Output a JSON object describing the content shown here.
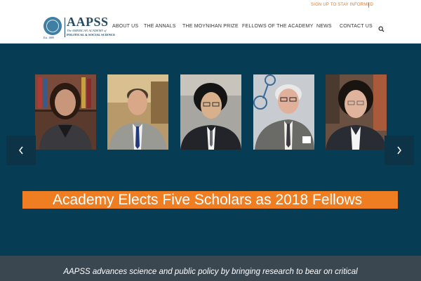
{
  "topbar": {
    "signup_label": "SIGN UP TO STAY INFORMED"
  },
  "logo": {
    "brand": "AAPSS",
    "subtitle_line1": "The AMERICAN ACADEMY of",
    "subtitle_line2": "POLITICAL & SOCIAL SCIENCE",
    "established": "Est. 1889"
  },
  "nav": {
    "items": [
      {
        "label": "ABOUT US"
      },
      {
        "label": "THE ANNALS"
      },
      {
        "label": "THE MOYNIHAN PRIZE"
      },
      {
        "label": "FELLOWS OF THE ACADEMY"
      },
      {
        "label": "NEWS"
      },
      {
        "label": "CONTACT US"
      }
    ],
    "search_icon": "search-icon"
  },
  "hero": {
    "headline": "Academy Elects Five Scholars as 2018 Fellows",
    "prev_icon": "chevron-left-icon",
    "next_icon": "chevron-right-icon",
    "fellow_count": 5
  },
  "mission": {
    "text": "AAPSS advances science and public policy by bringing research to bear on critical"
  },
  "colors": {
    "hero_bg": "#073c55",
    "accent_orange": "#ef7d22",
    "brand_navy": "#264a63",
    "mission_bg": "#3a4650"
  }
}
